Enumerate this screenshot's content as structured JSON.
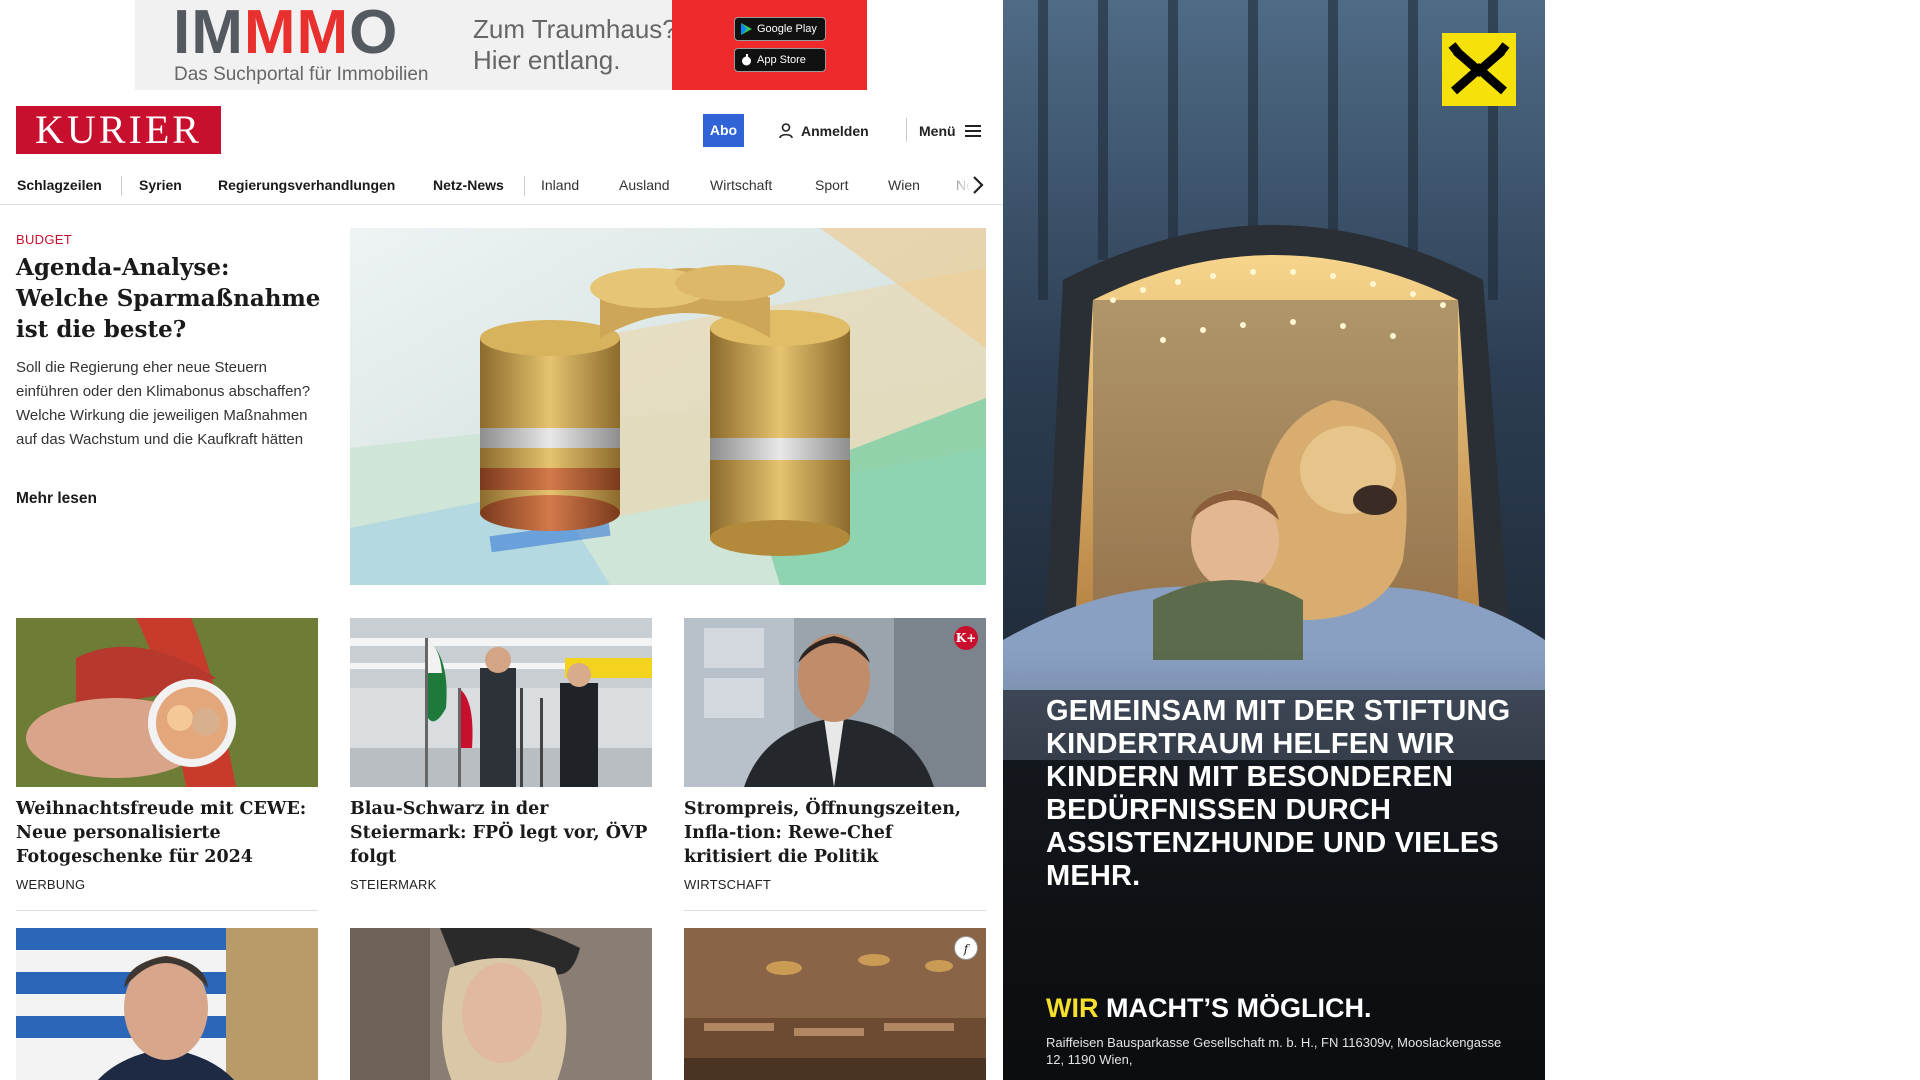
{
  "top_ad": {
    "brand_a": "IM",
    "brand_b": "MM",
    "brand_c": "O",
    "subline": "Das Suchportal für Immobilien",
    "claim_line1": "Zum Traumhaus?",
    "claim_line2": "Hier entlang.",
    "google_play": "Google Play",
    "app_store": "App Store"
  },
  "header": {
    "logo": "KURIER",
    "abo": "Abo",
    "login": "Anmelden",
    "menu": "Menü"
  },
  "nav": {
    "items": [
      "Schlagzeilen",
      "Syrien",
      "Regierungsverhandlungen",
      "Netz-News",
      "Inland",
      "Ausland",
      "Wirtschaft",
      "Sport",
      "Wien",
      "Nö"
    ]
  },
  "lead": {
    "kicker": "BUDGET",
    "title": "Agenda-Analyse: Welche Sparmaßnahme ist die beste?",
    "teaser": "Soll die Regierung eher neue Steuern einführen oder den Klimabonus abschaffen? Welche Wirkung die jeweiligen Maßnahmen auf das Wachstum und die Kaufkraft hätten",
    "more": "Mehr lesen"
  },
  "cards": [
    {
      "title": "Weihnachtsfreude mit CEWE: Neue personalisierte Fotogeschenke für 2024",
      "category": "WERBUNG"
    },
    {
      "title": "Blau-Schwarz in der Steiermark: FPÖ legt vor, ÖVP folgt",
      "category": "STEIERMARK"
    },
    {
      "title": "Strompreis, Öffnungszeiten, Infla-tion: Rewe-Chef kritisiert die Politik",
      "category": "WIRTSCHAFT",
      "badge": "K+"
    }
  ],
  "cards_row2_badge": "f",
  "side_ad": {
    "headline": "Gemeinsam mit der Stiftung Kindertraum helfen wir Kindern mit besonderen Bedürfnissen durch Assistenzhunde und vieles mehr.",
    "slogan_a": "WIR",
    "slogan_b": " MACHT’S MÖGLICH.",
    "legal": "Raiffeisen Bausparkasse Gesellschaft m. b. H., FN 116309v, Mooslackengasse 12, 1190 Wien,"
  },
  "colors": {
    "kurier_red": "#c8102e",
    "abo_blue": "#2f63d6",
    "ad_red": "#ee2a2c",
    "raiffeisen_yellow": "#f7e10b"
  }
}
